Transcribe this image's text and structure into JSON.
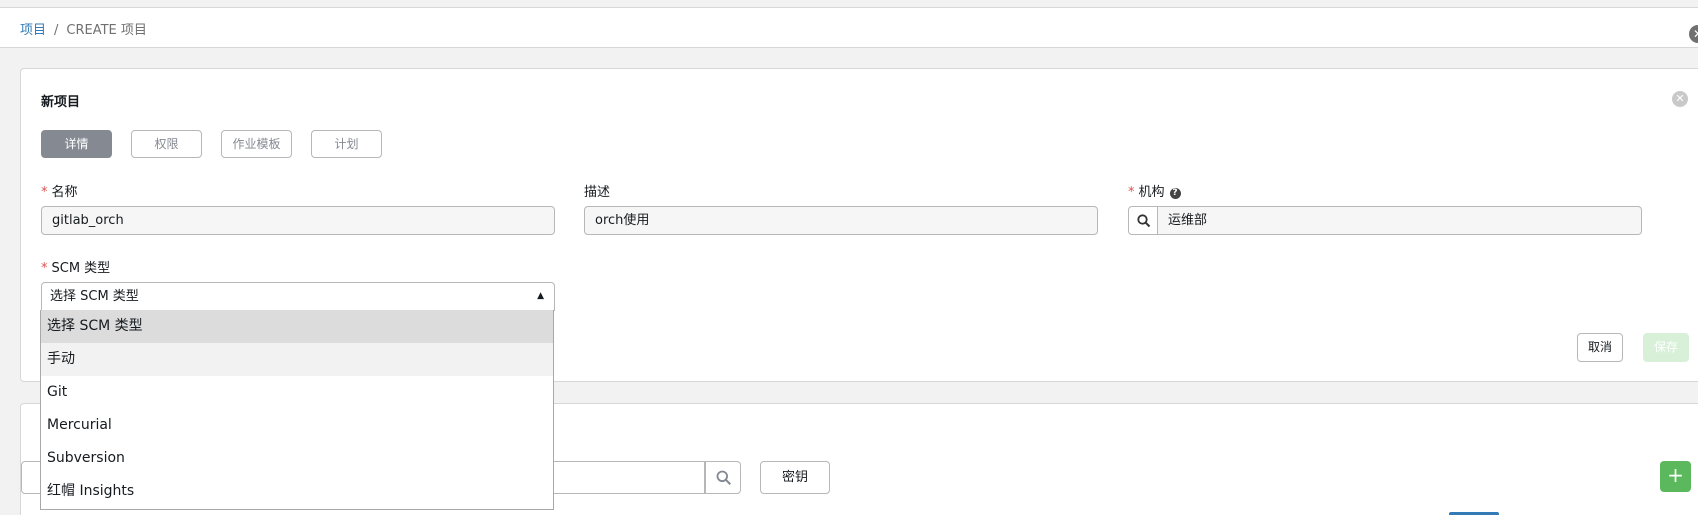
{
  "breadcrumb": {
    "link": "项目",
    "separator": "/",
    "current": "CREATE 项目"
  },
  "top_close_icon": "close-circle-icon",
  "form": {
    "title": "新项目",
    "close_icon": "close-circle-icon",
    "tabs": [
      {
        "label": "详情",
        "active": true
      },
      {
        "label": "权限",
        "active": false
      },
      {
        "label": "作业模板",
        "active": false
      },
      {
        "label": "计划",
        "active": false
      }
    ],
    "required_mark": "*",
    "name": {
      "label": "名称",
      "value": "gitlab_orch"
    },
    "description": {
      "label": "描述",
      "value": "orch使用"
    },
    "organization": {
      "label": "机构",
      "help_icon": "question-circle-icon",
      "help_glyph": "?",
      "search_icon": "search-icon",
      "value": "运维部"
    },
    "scm_type": {
      "label": "SCM 类型",
      "selected": "选择 SCM 类型",
      "caret_icon": "caret-up-icon",
      "options": [
        "选择 SCM 类型",
        "手动",
        "Git",
        "Mercurial",
        "Subversion",
        "红帽 Insights"
      ],
      "highlighted_index": 0,
      "hovered_index": 1
    },
    "cancel_label": "取消",
    "save_label": "保存"
  },
  "lower_panel": {
    "search_icon": "search-icon",
    "key_button_label": "密钥",
    "add_button_label": "+"
  },
  "colors": {
    "link": "#337ab7",
    "active_tab": "#848992",
    "required": "#d9534f",
    "add_button": "#5cb85c",
    "save_disabled": "#d8efd8"
  }
}
